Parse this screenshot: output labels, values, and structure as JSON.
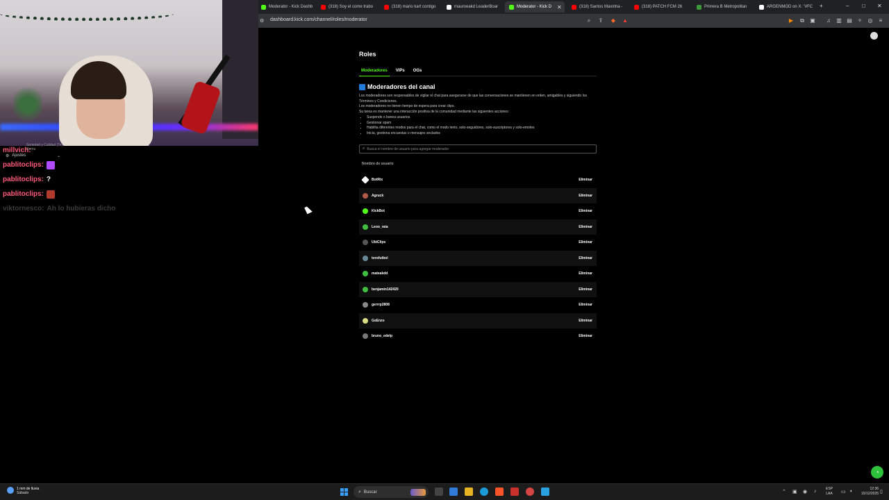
{
  "browser": {
    "tabs": [
      {
        "label": "Moderator - Kick Dashb",
        "color": "#53fc18"
      },
      {
        "label": "(318) Soy el come trabo",
        "color": "#ff0000"
      },
      {
        "label": "(318) mario kart contigo",
        "color": "#ff0000"
      },
      {
        "label": "mauroeakd LeaderBoar",
        "color": "#ffffff"
      },
      {
        "label": "Moderator - Kick D",
        "color": "#53fc18"
      },
      {
        "label": "(318) Santos Maxinha -",
        "color": "#ff0000"
      },
      {
        "label": "(318) PATCH FCM 26",
        "color": "#ff0000"
      },
      {
        "label": "Primera B Metropolitan",
        "color": "#3c9a3c"
      },
      {
        "label": "ARGENMOD on X: \"#FC",
        "color": "#ffffff"
      }
    ],
    "close_tab": "✕",
    "new_tab": "+",
    "url": "dashboard.kick.com/channel/roles/moderator"
  },
  "chat": {
    "top_user": "millvich:",
    "top_sub": "Seriedad y Calidad (Te) Remu",
    "settings_label": "Ajustes",
    "messages": [
      {
        "user": "pablitoclips:",
        "text": "",
        "emote_color": "#b04aff"
      },
      {
        "user": "pablitoclips:",
        "text": "?",
        "emote_color": ""
      },
      {
        "user": "pablitoclips:",
        "text": "",
        "emote_color": "#b03a2e"
      },
      {
        "user": "viktornesco:",
        "text": "Ah lo hubieras dicho",
        "emote_color": ""
      }
    ]
  },
  "page": {
    "title": "Roles",
    "tabs": [
      "Moderadores",
      "VIPs",
      "OGs"
    ],
    "section_title": "Moderadores del canal",
    "desc_lines": [
      "Los moderadores son responsables de vigilar el chat para asegurarse de que las conversaciones se mantienen en orden, amigables y siguiendo los Términos y Condiciones.",
      "Los moderadores no tienen tiempo de espera para crear clips.",
      "Su tarea es mantener una interacción positiva de la comunidad mediante las siguientes acciones:"
    ],
    "bullets": [
      "Suspende o banea usuarios",
      "Gestionar spam",
      "Habilita diferentes modos para el chat, como el modo lento, solo-seguidores, solo-suscriptores y solo-emotes",
      "Inicia, gestiona encuestas o mensajes anclados"
    ],
    "search_placeholder": "Busca el nombre de usuario para agregar moderador",
    "column_header": "Nombre de usuario",
    "remove_label": "Eliminar",
    "moderators": [
      {
        "name": "BotRix",
        "avatar_color": "#ffffff"
      },
      {
        "name": "Agruck",
        "avatar_color": "#b05a4a"
      },
      {
        "name": "KickBot",
        "avatar_color": "#53fc18"
      },
      {
        "name": "Leoo_raia",
        "avatar_color": "#3fbf3f"
      },
      {
        "name": "UbiClips",
        "avatar_color": "#555555"
      },
      {
        "name": "torofutbol",
        "avatar_color": "#6a8a9a"
      },
      {
        "name": "mateakdd",
        "avatar_color": "#3fbf3f"
      },
      {
        "name": "benjamin142420",
        "avatar_color": "#3fbf3f"
      },
      {
        "name": "gerrrp2808",
        "avatar_color": "#888888"
      },
      {
        "name": "GsEnzo",
        "avatar_color": "#dddd88"
      },
      {
        "name": "bruno_edelp",
        "avatar_color": "#777777"
      }
    ]
  },
  "taskbar": {
    "weather_temp": "1 mm de lluvia",
    "weather_day": "Sábado",
    "search_label": "Buscar",
    "lang_top": "ESP",
    "lang_bottom": "LAA",
    "time": "12:36",
    "date": "15/12/2025"
  }
}
